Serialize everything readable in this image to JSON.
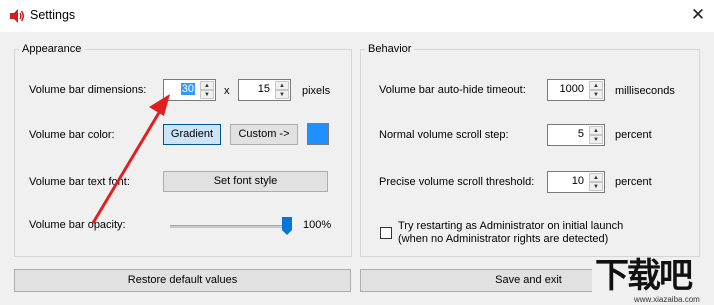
{
  "window": {
    "title": "Settings",
    "close_glyph": "✕",
    "icon": "speaker-icon"
  },
  "appearance": {
    "title": "Appearance",
    "dimensions_label": "Volume bar dimensions:",
    "width_value": "30",
    "times": "x",
    "height_value": "15",
    "units": "pixels",
    "color_label": "Volume bar color:",
    "gradient_btn": "Gradient",
    "custom_btn": "Custom ->",
    "swatch_color": "#1e90ff",
    "font_label": "Volume bar text font:",
    "font_btn": "Set font style",
    "opacity_label": "Volume bar opacity:",
    "opacity_value": "100%",
    "opacity_level": 1.0
  },
  "behavior": {
    "title": "Behavior",
    "timeout_label": "Volume bar auto-hide timeout:",
    "timeout_value": "1000",
    "timeout_units": "milliseconds",
    "step_label": "Normal volume scroll step:",
    "step_value": "5",
    "step_units": "percent",
    "threshold_label": "Precise volume scroll threshold:",
    "threshold_value": "10",
    "threshold_units": "percent",
    "admin_line1": "Try restarting as Administrator on initial launch",
    "admin_line2": "(when no Administrator rights are detected)",
    "admin_checked": false
  },
  "footer": {
    "restore_btn": "Restore default values",
    "save_btn": "Save and exit"
  },
  "watermark": {
    "text": "下载吧",
    "url_text": "www.xiazaiba.com"
  },
  "annotation": {
    "arrow_color": "#e02020"
  }
}
